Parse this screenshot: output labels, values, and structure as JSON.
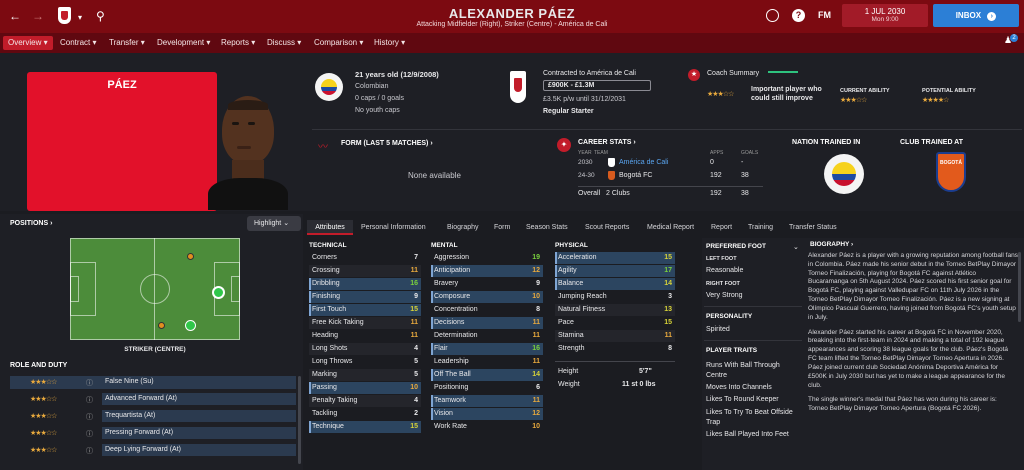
{
  "topbar": {
    "player_name": "ALEXANDER PÁEZ",
    "player_subtitle": "Attacking Midfielder (Right), Striker (Centre) - América de Cali",
    "date": "1 JUL 2030",
    "day_time": "Mon 9:00",
    "inbox_label": "INBOX",
    "fm_label": "FM",
    "help_label": "?"
  },
  "nav": [
    "Overview",
    "Contract",
    "Transfer",
    "Development",
    "Reports",
    "Discuss",
    "Comparison",
    "History"
  ],
  "badge_count": "2",
  "profile": {
    "photo_name": "PÁEZ",
    "age": "21 years old (12/9/2008)",
    "nationality": "Colombian",
    "caps": "0 caps / 0 goals",
    "youth_caps": "No youth caps",
    "contract_title": "Contracted to América de Cali",
    "value": "£900K - £1.3M",
    "wage": "£3.5K p/w until 31/12/2031",
    "squad_status": "Regular Starter",
    "coach_summary_title": "Coach Summary",
    "coach_summary_text": "Important player who could still improve",
    "current_ability_label": "CURRENT ABILITY",
    "potential_ability_label": "POTENTIAL ABILITY",
    "current_ability_stars": 3.5,
    "potential_ability_stars": 4.5,
    "coach_summary_stars": 3.5,
    "form_title": "FORM (LAST 5 MATCHES)",
    "form_empty": "None available",
    "career_title": "CAREER STATS",
    "career_headers": {
      "year": "YEAR",
      "team": "TEAM",
      "apps": "APPS",
      "goals": "GOALS"
    },
    "career_rows": [
      {
        "year": "2030",
        "team": "América de Cali",
        "apps": "0",
        "goals": "-"
      },
      {
        "year": "24-30",
        "team": "Bogotá FC",
        "apps": "192",
        "goals": "38"
      }
    ],
    "career_total": {
      "label": "Overall",
      "clubs": "2 Clubs",
      "apps": "192",
      "goals": "38"
    },
    "nation_trained_label": "NATION TRAINED IN",
    "club_trained_label": "CLUB TRAINED AT",
    "club_trained_badge_text": "BOGOTÁ"
  },
  "left": {
    "positions_title": "POSITIONS",
    "highlight_label": "Highlight",
    "position_name": "STRIKER (CENTRE)",
    "role_title": "ROLE AND DUTY",
    "roles": [
      {
        "name": "False Nine (Su)",
        "stars": 3
      },
      {
        "name": "Advanced Forward (At)",
        "stars": 3
      },
      {
        "name": "Trequartista (At)",
        "stars": 3
      },
      {
        "name": "Pressing Forward (At)",
        "stars": 3
      },
      {
        "name": "Deep Lying Forward (At)",
        "stars": 3
      }
    ]
  },
  "tabs": [
    "Attributes",
    "Personal Information",
    "Biography",
    "Form",
    "Season Stats",
    "Scout Reports",
    "Medical Report",
    "Report",
    "Training",
    "Transfer Status"
  ],
  "attributes": {
    "technical_title": "TECHNICAL",
    "mental_title": "MENTAL",
    "physical_title": "PHYSICAL",
    "technical": [
      {
        "name": "Corners",
        "value": "7"
      },
      {
        "name": "Crossing",
        "value": "11"
      },
      {
        "name": "Dribbling",
        "value": "16"
      },
      {
        "name": "Finishing",
        "value": "9"
      },
      {
        "name": "First Touch",
        "value": "15"
      },
      {
        "name": "Free Kick Taking",
        "value": "11"
      },
      {
        "name": "Heading",
        "value": "11"
      },
      {
        "name": "Long Shots",
        "value": "4"
      },
      {
        "name": "Long Throws",
        "value": "5"
      },
      {
        "name": "Marking",
        "value": "5"
      },
      {
        "name": "Passing",
        "value": "10"
      },
      {
        "name": "Penalty Taking",
        "value": "4"
      },
      {
        "name": "Tackling",
        "value": "2"
      },
      {
        "name": "Technique",
        "value": "15"
      }
    ],
    "mental": [
      {
        "name": "Aggression",
        "value": "19"
      },
      {
        "name": "Anticipation",
        "value": "12"
      },
      {
        "name": "Bravery",
        "value": "9"
      },
      {
        "name": "Composure",
        "value": "10"
      },
      {
        "name": "Concentration",
        "value": "8"
      },
      {
        "name": "Decisions",
        "value": "11"
      },
      {
        "name": "Determination",
        "value": "11"
      },
      {
        "name": "Flair",
        "value": "16"
      },
      {
        "name": "Leadership",
        "value": "11"
      },
      {
        "name": "Off The Ball",
        "value": "14"
      },
      {
        "name": "Positioning",
        "value": "6"
      },
      {
        "name": "Teamwork",
        "value": "11"
      },
      {
        "name": "Vision",
        "value": "12"
      },
      {
        "name": "Work Rate",
        "value": "10"
      }
    ],
    "physical": [
      {
        "name": "Acceleration",
        "value": "15"
      },
      {
        "name": "Agility",
        "value": "17"
      },
      {
        "name": "Balance",
        "value": "14"
      },
      {
        "name": "Jumping Reach",
        "value": "3"
      },
      {
        "name": "Natural Fitness",
        "value": "13"
      },
      {
        "name": "Pace",
        "value": "15"
      },
      {
        "name": "Stamina",
        "value": "11"
      },
      {
        "name": "Strength",
        "value": "8"
      }
    ],
    "height_label": "Height",
    "height_value": "5'7\"",
    "weight_label": "Weight",
    "weight_value": "11 st 0 lbs"
  },
  "right": {
    "preferred_foot_title": "PREFERRED FOOT",
    "left_foot_label": "LEFT FOOT",
    "left_foot_value": "Reasonable",
    "right_foot_label": "RIGHT FOOT",
    "right_foot_value": "Very Strong",
    "personality_title": "PERSONALITY",
    "personality_value": "Spirited",
    "traits_title": "PLAYER TRAITS",
    "traits": [
      "Runs With Ball Through Centre",
      "Moves Into Channels",
      "Likes To Round Keeper",
      "Likes To Try To Beat Offside Trap",
      "Likes Ball Played Into Feet"
    ],
    "bio_title": "BIOGRAPHY",
    "bio_p1": "Alexander Páez is a player with a growing reputation among football fans in Colombia. Páez made his senior debut in the Torneo BetPlay Dimayor Torneo Finalización, playing for Bogotá FC against Atlético Bucaramanga on 5th August 2024. Páez scored his first senior goal for Bogotá FC, playing against Valledupar FC on 11th July 2026 in the Torneo BetPlay Dimayor Torneo Finalización. Páez is a new signing at Olímpico Pascual Guerrero, having joined from Bogotá FC's youth setup in July.",
    "bio_p2": "Alexander Páez started his career at Bogotá FC in November 2020, breaking into the first-team in 2024 and making a total of 192 league appearances and scoring 38 league goals for the club. Páez's Bogotá FC team lifted the Torneo BetPlay Dimayor Torneo Apertura in 2026. Páez joined current club Sociedad Anónima Deportiva América for £500K in July 2030 but has yet to make a league appearance for the club.",
    "bio_p3": "The single winner's medal that Páez has won during his career is: Torneo BetPlay Dimayor Torneo Apertura (Bogotá FC 2026)."
  },
  "colors": {
    "topbar": "#7c0a11",
    "nav": "#600810",
    "accent": "#c21c2a",
    "inbox": "#2c7fd6",
    "highlight_row": "#2c4560"
  }
}
